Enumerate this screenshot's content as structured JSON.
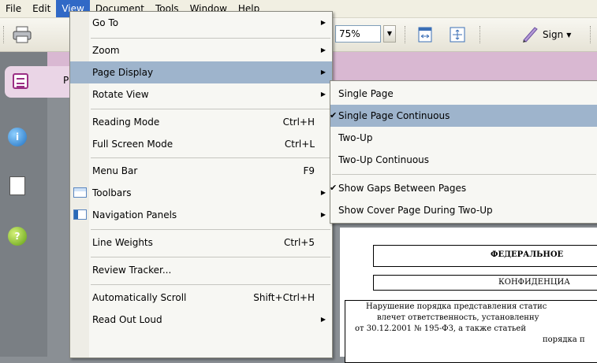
{
  "menubar": {
    "items": [
      {
        "label": "File"
      },
      {
        "label": "Edit"
      },
      {
        "label": "View"
      },
      {
        "label": "Document"
      },
      {
        "label": "Tools"
      },
      {
        "label": "Window"
      },
      {
        "label": "Help"
      }
    ],
    "active_index": 2
  },
  "toolbar": {
    "zoom_value": "75%",
    "sign_label": "Sign"
  },
  "navpanel": {
    "tab_label": "P"
  },
  "view_menu": {
    "items": [
      {
        "label": "Go To",
        "mnemonic": "G",
        "shortcut": "",
        "submenu": true
      },
      {
        "label": "Zoom",
        "mnemonic": "Z",
        "shortcut": "",
        "submenu": true
      },
      {
        "label": "Page Display",
        "mnemonic": "P",
        "shortcut": "",
        "submenu": true,
        "highlighted": true
      },
      {
        "label": "Rotate View",
        "mnemonic": "V",
        "shortcut": "",
        "submenu": true
      },
      {
        "label": "Reading Mode",
        "mnemonic": "R",
        "shortcut": "Ctrl+H"
      },
      {
        "label": "Full Screen Mode",
        "mnemonic": "F",
        "shortcut": "Ctrl+L"
      },
      {
        "label": "Menu Bar",
        "mnemonic": "M",
        "shortcut": "F9"
      },
      {
        "label": "Toolbars",
        "mnemonic": "T",
        "shortcut": "",
        "submenu": true,
        "icon": "toolbars-icon"
      },
      {
        "label": "Navigation Panels",
        "mnemonic": "N",
        "shortcut": "",
        "submenu": true,
        "icon": "navigation-panels-icon"
      },
      {
        "label": "Line Weights",
        "mnemonic": "L",
        "shortcut": "Ctrl+5"
      },
      {
        "label": "Review Tracker...",
        "mnemonic": "k",
        "shortcut": ""
      },
      {
        "label": "Automatically Scroll",
        "mnemonic": "y",
        "shortcut": "Shift+Ctrl+H"
      },
      {
        "label": "Read Out Loud",
        "mnemonic": "a",
        "shortcut": "",
        "submenu": true
      }
    ]
  },
  "page_display_menu": {
    "items": [
      {
        "label": "Single Page",
        "mnemonic": "S",
        "checked": false
      },
      {
        "label": "Single Page Continuous",
        "mnemonic": "C",
        "checked": true,
        "highlighted": true
      },
      {
        "label": "Two-Up",
        "mnemonic": "U",
        "checked": false
      },
      {
        "label": "Two-Up Continuous",
        "mnemonic": "T",
        "checked": false
      },
      {
        "label": "Show Gaps Between Pages",
        "mnemonic": "G",
        "checked": true
      },
      {
        "label": "Show Cover Page During Two-Up",
        "mnemonic": "v",
        "checked": false
      }
    ]
  },
  "document": {
    "line1": "ФЕДЕРАЛЬНОЕ",
    "line2": "КОНФИДЕНЦИА",
    "para1": "Нарушение порядка представления статис",
    "para2": "влечет ответственность, установленну",
    "para3": "от 30.12.2001 № 195-ФЗ, а также статьей",
    "para4": "порядка п"
  },
  "colors": {
    "menu_highlight": "#9eb4cc",
    "menubar_active": "#3169c6",
    "pink_header": "#d9b8d2"
  }
}
